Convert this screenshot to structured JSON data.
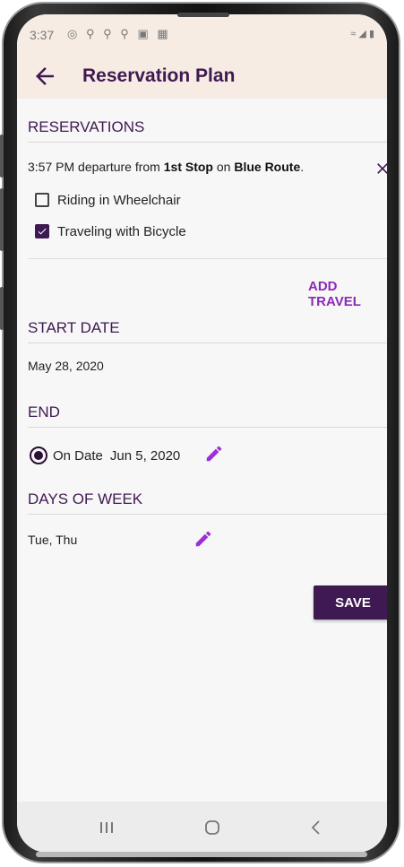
{
  "status_bar": {
    "time": "3:37",
    "left_icons": [
      "location-icon",
      "pin-icon",
      "pin-icon",
      "pin-icon",
      "image-icon",
      "notification-icon"
    ],
    "right_icons": [
      "wifi-icon",
      "signal-icon",
      "battery-icon"
    ]
  },
  "app_bar": {
    "title": "Reservation Plan",
    "back_icon": "arrow-left-icon"
  },
  "reservations": {
    "header": "RESERVATIONS",
    "item": {
      "prefix": "3:57 PM departure from ",
      "stop": "1st Stop",
      "middle": " on ",
      "route": "Blue Route",
      "suffix": "."
    },
    "options": [
      {
        "label": "Riding in Wheelchair",
        "checked": false
      },
      {
        "label": "Traveling with Bicycle",
        "checked": true
      }
    ],
    "add_travel_label": "ADD TRAVEL"
  },
  "start_date": {
    "header": "START DATE",
    "value": "May 28, 2020"
  },
  "end": {
    "header": "END",
    "option_label": "On Date",
    "option_value": "Jun 5, 2020",
    "selected": true
  },
  "days_of_week": {
    "header": "DAYS OF WEEK",
    "value": "Tue, Thu"
  },
  "save_label": "SAVE",
  "colors": {
    "primary": "#3f1a52",
    "accent": "#8a2bb5",
    "app_bar_bg": "#f6ece4",
    "background": "#f7f7f7"
  },
  "nav_bar": {
    "icons": [
      "recent-apps-icon",
      "home-icon",
      "back-icon"
    ]
  }
}
